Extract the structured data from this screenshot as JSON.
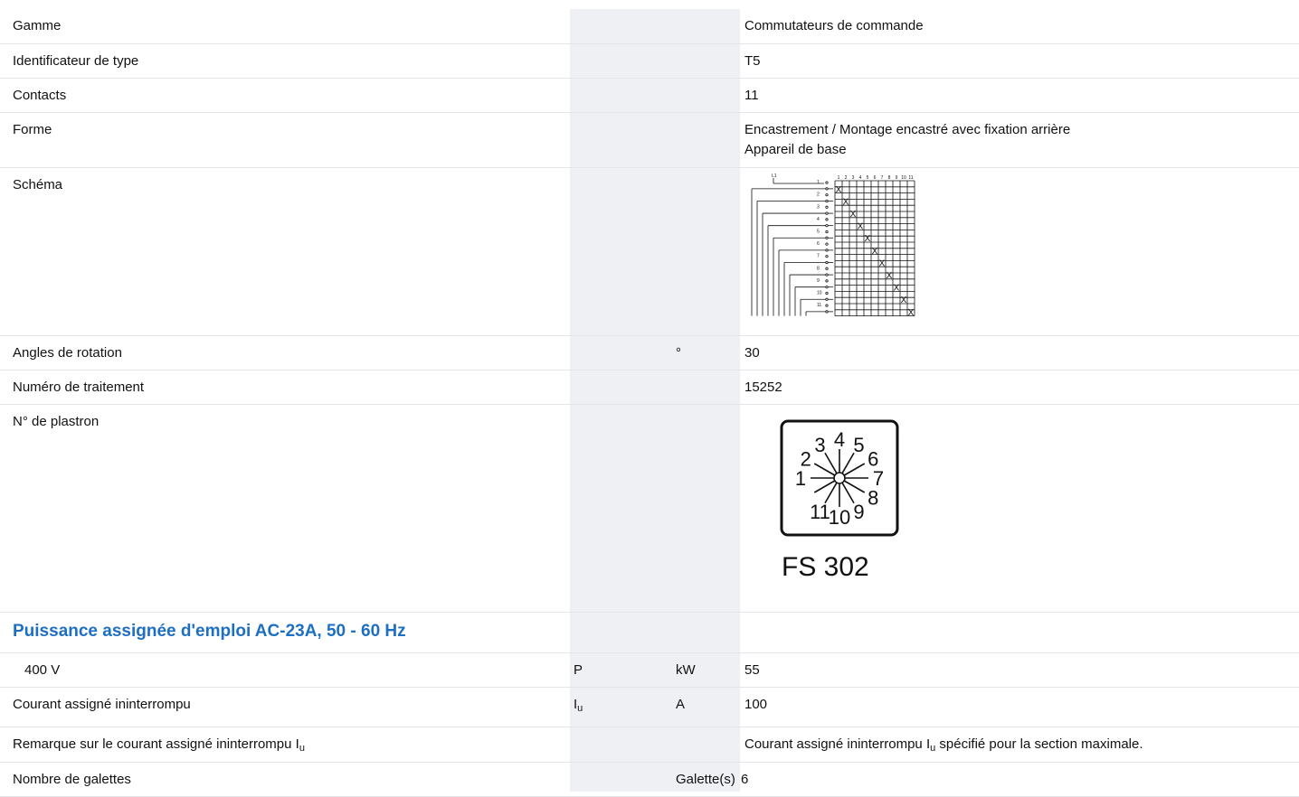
{
  "rows": [
    {
      "label": "Gamme",
      "value": "Commutateurs de commande"
    },
    {
      "label": "Identificateur de type",
      "value": "T5"
    },
    {
      "label": "Contacts",
      "value": "11"
    },
    {
      "label": "Forme",
      "value_lines": [
        "Encastrement / Montage encastré avec fixation arrière",
        "Appareil de base"
      ]
    },
    {
      "label": "Schéma"
    },
    {
      "label": "Angles de rotation",
      "unit": "°",
      "value": "30"
    },
    {
      "label": "Numéro de traitement",
      "value": "15252"
    },
    {
      "label": "N° de plastron",
      "plate_code": "FS 302",
      "dial_numbers": [
        "1",
        "2",
        "3",
        "4",
        "5",
        "6",
        "7",
        "8",
        "9",
        "10",
        "11"
      ]
    },
    {
      "section": "Puissance assignée d'emploi AC-23A, 50 - 60 Hz"
    },
    {
      "label": "400 V",
      "symbol": "P",
      "unit": "kW",
      "value": "55"
    },
    {
      "label": "Courant assigné ininterrompu",
      "symbol": "I",
      "symbol_sub": "u",
      "unit": "A",
      "value": "100"
    },
    {
      "label": "Remarque sur le courant assigné ininterrompu I",
      "label_sub": "u",
      "value_pre": "Courant assigné ininterrompu I",
      "value_sub": "u",
      "value_post": " spécifié pour la section maximale."
    },
    {
      "label": "Nombre de galettes",
      "unit": "Galette(s)",
      "value": "6"
    }
  ],
  "schema": {
    "top_label": "L1",
    "column_numbers": [
      "1",
      "2",
      "3",
      "4",
      "5",
      "6",
      "7",
      "8",
      "9",
      "10",
      "11"
    ],
    "mark": "X"
  }
}
